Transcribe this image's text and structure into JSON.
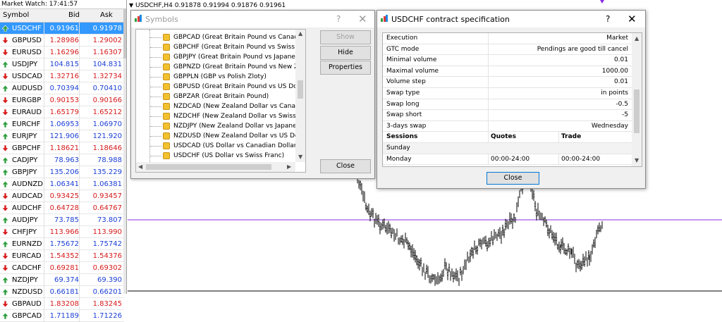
{
  "market_watch": {
    "title": "Market Watch: 17:41:57",
    "headers": {
      "symbol": "Symbol",
      "bid": "Bid",
      "ask": "Ask"
    },
    "rows": [
      {
        "symbol": "USDCHF",
        "bid": "0.91961",
        "ask": "0.91978",
        "dir": "up",
        "selected": true
      },
      {
        "symbol": "GBPUSD",
        "bid": "1.28986",
        "ask": "1.29002",
        "dir": "dn"
      },
      {
        "symbol": "EURUSD",
        "bid": "1.16296",
        "ask": "1.16307",
        "dir": "dn"
      },
      {
        "symbol": "USDJPY",
        "bid": "104.815",
        "ask": "104.831",
        "dir": "up"
      },
      {
        "symbol": "USDCAD",
        "bid": "1.32716",
        "ask": "1.32734",
        "dir": "dn"
      },
      {
        "symbol": "AUDUSD",
        "bid": "0.70394",
        "ask": "0.70410",
        "dir": "up"
      },
      {
        "symbol": "EURGBP",
        "bid": "0.90153",
        "ask": "0.90166",
        "dir": "dn"
      },
      {
        "symbol": "EURAUD",
        "bid": "1.65179",
        "ask": "1.65212",
        "dir": "dn"
      },
      {
        "symbol": "EURCHF",
        "bid": "1.06953",
        "ask": "1.06970",
        "dir": "up"
      },
      {
        "symbol": "EURJPY",
        "bid": "121.906",
        "ask": "121.920",
        "dir": "up"
      },
      {
        "symbol": "GBPCHF",
        "bid": "1.18621",
        "ask": "1.18646",
        "dir": "dn"
      },
      {
        "symbol": "CADJPY",
        "bid": "78.963",
        "ask": "78.988",
        "dir": "up"
      },
      {
        "symbol": "GBPJPY",
        "bid": "135.206",
        "ask": "135.229",
        "dir": "up"
      },
      {
        "symbol": "AUDNZD",
        "bid": "1.06341",
        "ask": "1.06381",
        "dir": "up"
      },
      {
        "symbol": "AUDCAD",
        "bid": "0.93425",
        "ask": "0.93457",
        "dir": "dn"
      },
      {
        "symbol": "AUDCHF",
        "bid": "0.64728",
        "ask": "0.64767",
        "dir": "dn"
      },
      {
        "symbol": "AUDJPY",
        "bid": "73.785",
        "ask": "73.807",
        "dir": "up"
      },
      {
        "symbol": "CHFJPY",
        "bid": "113.966",
        "ask": "113.990",
        "dir": "dn"
      },
      {
        "symbol": "EURNZD",
        "bid": "1.75672",
        "ask": "1.75742",
        "dir": "up"
      },
      {
        "symbol": "EURCAD",
        "bid": "1.54352",
        "ask": "1.54376",
        "dir": "dn"
      },
      {
        "symbol": "CADCHF",
        "bid": "0.69281",
        "ask": "0.69302",
        "dir": "dn"
      },
      {
        "symbol": "NZDJPY",
        "bid": "69.374",
        "ask": "69.390",
        "dir": "up"
      },
      {
        "symbol": "NZDUSD",
        "bid": "0.66181",
        "ask": "0.66201",
        "dir": "up"
      },
      {
        "symbol": "GBPAUD",
        "bid": "1.83208",
        "ask": "1.83245",
        "dir": "dn"
      },
      {
        "symbol": "GBPCAD",
        "bid": "1.71189",
        "ask": "1.71226",
        "dir": "up"
      }
    ]
  },
  "chart": {
    "title": "USDCHF,H4  0.91878 0.91994 0.91876 0.91961",
    "line_color": "#8a2be2"
  },
  "symbols_dialog": {
    "title": "Symbols",
    "items": [
      "GBPCAD  (Great Britain Pound vs Canadian Dollar)",
      "GBPCHF  (Great Britain Pound vs Swiss Franc)",
      "GBPJPY  (Great Britain Pound vs Japanese Yen)",
      "GBPNZD  (Great Britain Pound vs New Zealand Dolla",
      "GBPPLN  (GBP vs Polish Zloty)",
      "GBPUSD  (Great Britain Pound vs US Dollar)",
      "GBPZAR  (Great Britain Pound)",
      "NZDCAD  (New Zealand Dollar vs Canadian Dollar)",
      "NZDCHF  (New Zealand Dollar vs Swiss Franc)",
      "NZDJPY  (New Zealand Dollar vs Japanese Yen)",
      "NZDUSD  (New Zealand Dollar vs US Dollar)",
      "USDCAD  (US Dollar vs Canadian Dollar)",
      "USDCHF  (US Dollar vs Swiss Franc)"
    ],
    "buttons": {
      "show": "Show",
      "hide": "Hide",
      "properties": "Properties",
      "close": "Close"
    },
    "help": "?",
    "close_glyph": "✕"
  },
  "spec_dialog": {
    "title": "USDCHF contract specification",
    "help": "?",
    "close_glyph": "✕",
    "rows": [
      {
        "k": "Execution",
        "v": "Market"
      },
      {
        "k": "GTC mode",
        "v": "Pendings are good till cancel"
      },
      {
        "k": "Minimal volume",
        "v": "0.01"
      },
      {
        "k": "Maximal volume",
        "v": "1000.00"
      },
      {
        "k": "Volume step",
        "v": "0.01"
      },
      {
        "k": "Swap type",
        "v": "in points"
      },
      {
        "k": "Swap long",
        "v": "-0.5"
      },
      {
        "k": "Swap short",
        "v": "-5"
      },
      {
        "k": "3-days swap",
        "v": "Wednesday"
      }
    ],
    "sessions_header": {
      "sessions": "Sessions",
      "quotes": "Quotes",
      "trade": "Trade"
    },
    "sessions": [
      {
        "day": "Sunday",
        "quotes": "",
        "trade": ""
      },
      {
        "day": "Monday",
        "quotes": "00:00-24:00",
        "trade": "00:00-24:00"
      }
    ],
    "close_button": "Close"
  }
}
